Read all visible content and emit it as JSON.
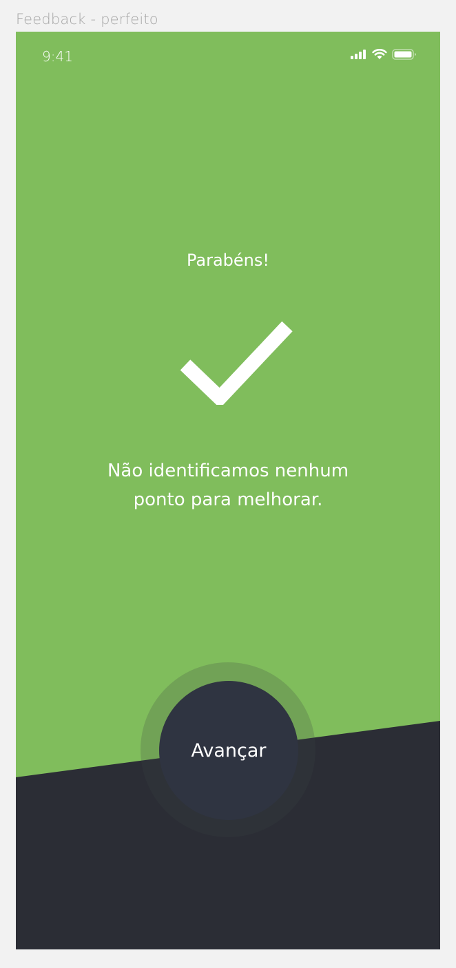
{
  "frame": {
    "label": "Feedback - perfeito"
  },
  "status_bar": {
    "time": "9:41",
    "icons": [
      "cellular-signal-icon",
      "wifi-icon",
      "battery-icon"
    ]
  },
  "feedback": {
    "title": "Parabéns!",
    "icon": "checkmark-icon",
    "message": "Não identificamos nenhum ponto para melhorar."
  },
  "actions": {
    "next_label": "Avançar"
  },
  "colors": {
    "success_green": "#80bd5c",
    "dark_panel": "#2b2d35",
    "button": "#2f3441",
    "text": "#ffffff"
  }
}
